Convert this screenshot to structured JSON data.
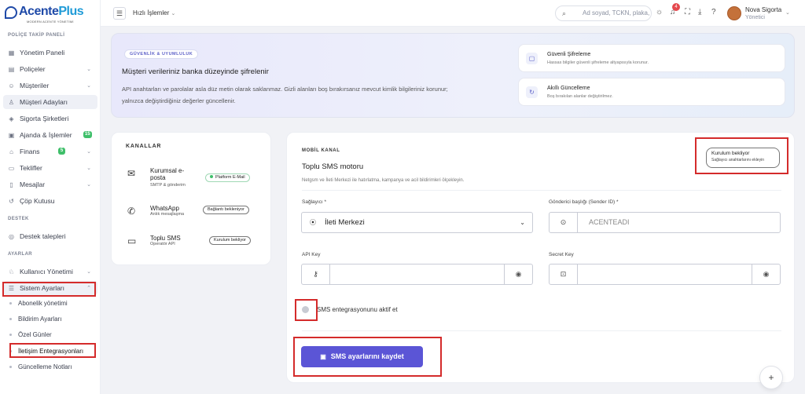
{
  "brand": {
    "name_a": "Acente",
    "name_b": "Plus",
    "tagline": "MODERN ACENTE YÖNETİMİ"
  },
  "sidebar": {
    "sections": [
      "POLİÇE TAKİP PANELİ",
      "DESTEK",
      "AYARLAR"
    ],
    "items": [
      {
        "label": "Yönetim Paneli",
        "icon": "grid-icon"
      },
      {
        "label": "Poliçeler",
        "icon": "document-icon"
      },
      {
        "label": "Müşteriler",
        "icon": "users-icon"
      },
      {
        "label": "Müşteri Adayları",
        "icon": "user-plus-icon"
      },
      {
        "label": "Sigorta Şirketleri",
        "icon": "shield-icon"
      },
      {
        "label": "Ajanda & İşlemler",
        "icon": "calendar-icon",
        "badge": "15"
      },
      {
        "label": "Finans",
        "icon": "bank-icon",
        "badge": "5"
      },
      {
        "label": "Teklifler",
        "icon": "file-icon"
      },
      {
        "label": "Mesajlar",
        "icon": "phone-icon"
      },
      {
        "label": "Çöp Kutusu",
        "icon": "trash-icon"
      },
      {
        "label": "Destek talepleri",
        "icon": "support-icon"
      },
      {
        "label": "Kullanıcı Yönetimi",
        "icon": "user-key-icon"
      },
      {
        "label": "Sistem Ayarları",
        "icon": "settings-icon"
      }
    ],
    "sub_items": [
      "Abonelik yönetimi",
      "Bildirim Ayarları",
      "Özel Günler",
      "İletişim Entegrasyonları",
      "Güncelleme Notları"
    ]
  },
  "topbar": {
    "quick_actions": "Hızlı İşlemler",
    "search_placeholder": "Ad soyad, TCKN, plaka,",
    "notification_count": "4",
    "user_name": "Nova Sigorta",
    "user_role": "Yönetici"
  },
  "hero": {
    "pill": "GÜVENLİK & UYUMLULUK",
    "title": "Müşteri verileriniz banka düzeyinde şifrelenir",
    "desc": "API anahtarları ve parolalar asla düz metin olarak saklanmaz. Gizli alanları boş bırakırsanız mevcut kimlik bilgileriniz korunur; yalnızca değiştirdiğiniz değerler güncellenir.",
    "cards": [
      {
        "title": "Güvenli Şifreleme",
        "subtitle": "Hassas bilgiler güvenli şifreleme altyapısıyla korunur."
      },
      {
        "title": "Akıllı Güncelleme",
        "subtitle": "Boş bırakılan alanlar değiştirilmez."
      }
    ]
  },
  "channels": {
    "caption": "KANALLAR",
    "items": [
      {
        "name": "Kurumsal e-posta",
        "desc": "SMTP & gönderim",
        "tag": "Platform E-Mail",
        "icon": "mail-icon"
      },
      {
        "name": "WhatsApp",
        "desc": "Anlık mesajlaşma",
        "tag": "Bağlantı bekleniyor",
        "icon": "whatsapp-icon"
      },
      {
        "name": "Toplu SMS",
        "desc": "Operatör API",
        "tag": "Kurulum bekliyor",
        "icon": "chat-icon"
      }
    ]
  },
  "panel": {
    "caption": "MOBİL KANAL",
    "title": "Toplu SMS motoru",
    "subtitle": "Netgsm ve İleti Merkezi ile hatırlatma, kampanya ve acil bildirimleri ölçekleyin.",
    "status_title": "Kurulum bekliyor",
    "status_sub": "Sağlayıcı anahtarlarını ekleyin",
    "provider_label": "Sağlayıcı *",
    "provider_value": "İleti Merkezi",
    "sender_label": "Gönderici başlığı (Sender ID) *",
    "sender_placeholder": "ACENTEADI",
    "api_key_label": "API Key",
    "secret_key_label": "Secret Key",
    "toggle_label": "SMS entegrasyonunu aktif et",
    "save_label": "SMS ayarlarını kaydet"
  },
  "colors": {
    "accent": "#5b55d6",
    "highlight": "#d42b2b",
    "brand": "#1f4aa8"
  }
}
